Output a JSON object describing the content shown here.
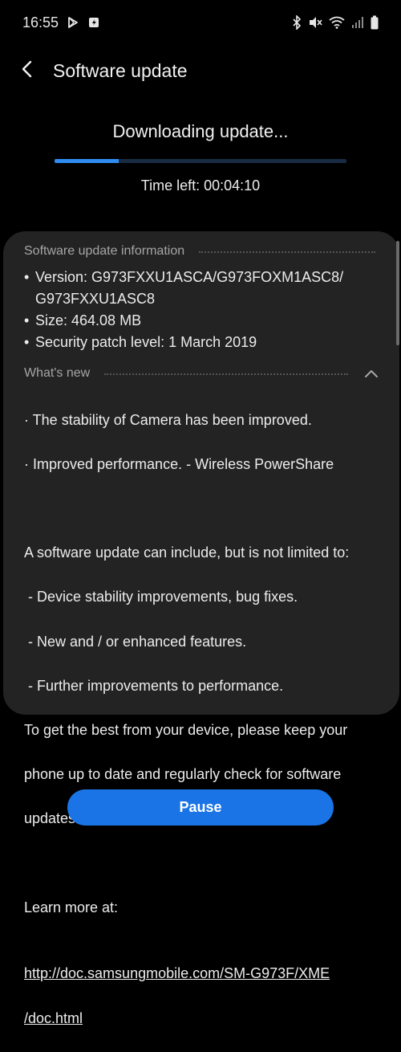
{
  "status_bar": {
    "time": "16:55",
    "left_icons": [
      "play-store-icon",
      "download-app-icon"
    ],
    "right_icons": [
      "bluetooth-icon",
      "mute-icon",
      "wifi-icon",
      "signal-icon",
      "battery-icon"
    ]
  },
  "app_bar": {
    "title": "Software update",
    "back_icon": "chevron-left-icon"
  },
  "download": {
    "title": "Downloading update...",
    "progress_fraction": 0.22,
    "time_left": "Time left: 00:04:10"
  },
  "info": {
    "header": "Software update information",
    "version_line1": "Version: G973FXXU1ASCA/G973FOXM1ASC8/",
    "version_line2": "G973FXXU1ASC8",
    "size": "Size: 464.08 MB",
    "security_patch": "Security patch level: 1 March 2019"
  },
  "whats_new": {
    "header": "What's new",
    "collapse_icon": "chevron-up-icon",
    "line1": "· The stability of Camera has been improved.",
    "line2": "· Improved performance. - Wireless PowerShare",
    "line3": "A software update can include, but is not limited to:",
    "line4": " - Device stability improvements, bug fixes.",
    "line5": " - New and / or enhanced features.",
    "line6": " - Further improvements to performance.",
    "line7": "To get the best from your device, please keep your",
    "line8": "phone up to date and regularly check for software",
    "line9": "updates.",
    "learn_more": "Learn more at:",
    "link_line1": "http://doc.samsungmobile.com/SM-G973F/XME",
    "link_line2": "/doc.html"
  },
  "actions": {
    "pause_label": "Pause"
  },
  "colors": {
    "background": "#000000",
    "card": "#232323",
    "accent": "#1a74e6",
    "progress": "#2f8cf0"
  }
}
